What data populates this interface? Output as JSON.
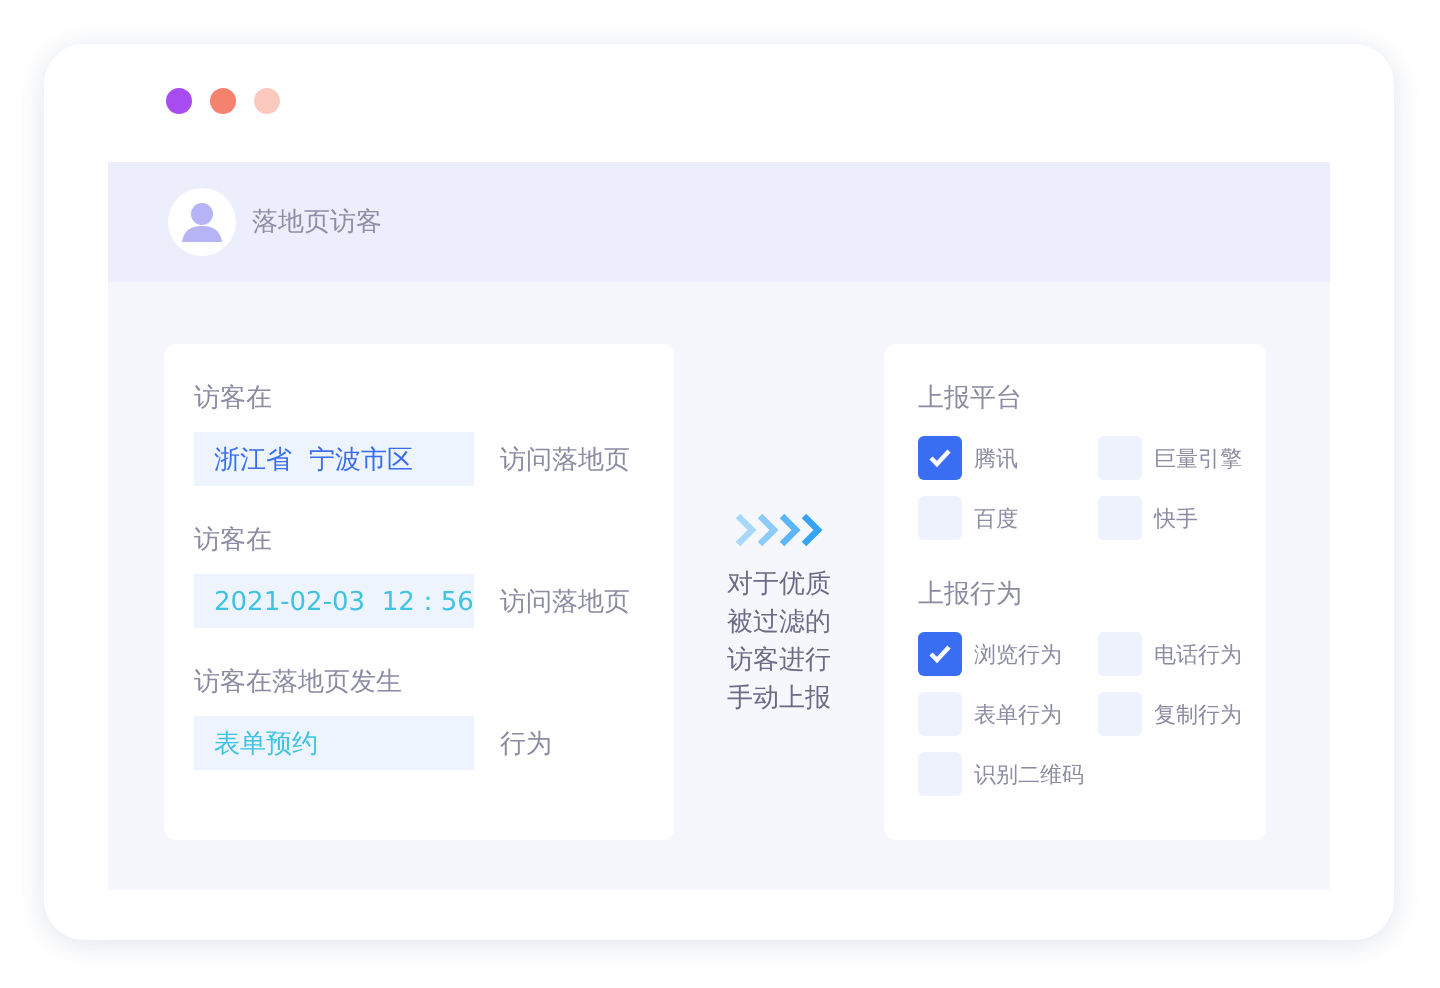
{
  "window_dots": [
    {
      "color": "#a64cf0"
    },
    {
      "color": "#f5826f"
    },
    {
      "color": "#fbc9bd"
    }
  ],
  "header": {
    "title": "落地页访客"
  },
  "conditions": [
    {
      "label": "访客在",
      "value": "浙江省  宁波市区",
      "color": "#3a6ef2",
      "suffix": "访问落地页"
    },
    {
      "label": "访客在",
      "value": "2021-02-03  12：56",
      "color": "#3fc3e3",
      "suffix": "访问落地页"
    },
    {
      "label": "访客在落地页发生",
      "value": "表单预约",
      "color": "#3fc3e3",
      "suffix": "行为"
    }
  ],
  "middle": {
    "text": "对于优质被过滤的访客进行手动上报"
  },
  "groups": [
    {
      "title": "上报平台",
      "options": [
        {
          "label": "腾讯",
          "checked": true
        },
        {
          "label": "巨量引擎",
          "checked": false
        },
        {
          "label": "百度",
          "checked": false
        },
        {
          "label": "快手",
          "checked": false
        }
      ]
    },
    {
      "title": "上报行为",
      "options": [
        {
          "label": "浏览行为",
          "checked": true
        },
        {
          "label": "电话行为",
          "checked": false
        },
        {
          "label": "表单行为",
          "checked": false
        },
        {
          "label": "复制行为",
          "checked": false
        },
        {
          "label": "识别二维码",
          "checked": false
        }
      ]
    }
  ]
}
